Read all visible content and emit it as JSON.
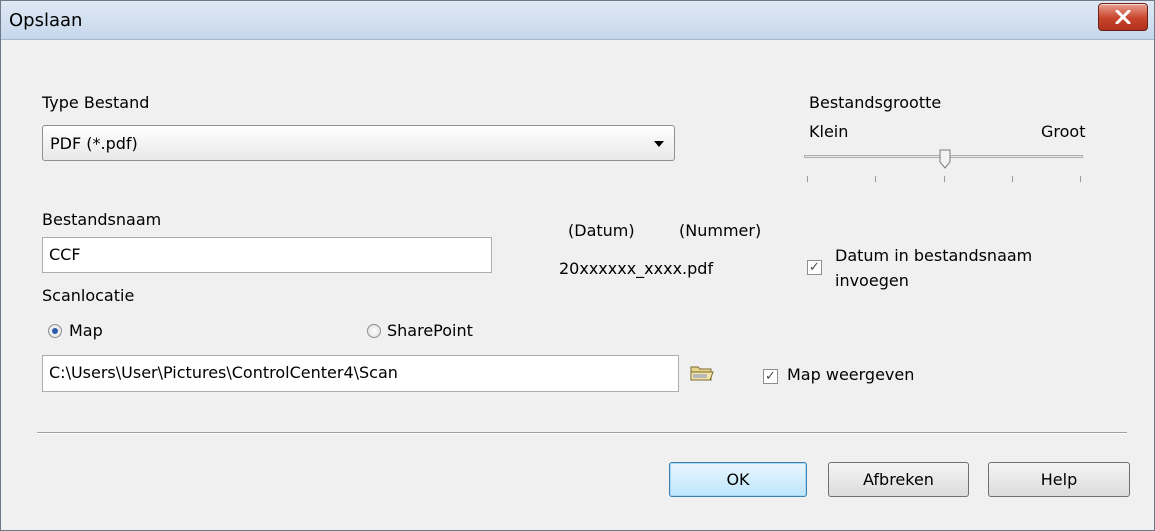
{
  "window": {
    "title": "Opslaan",
    "close_icon": "close-icon"
  },
  "file_type": {
    "label": "Type Bestand",
    "value": "PDF (*.pdf)"
  },
  "file_size": {
    "label": "Bestandsgrootte",
    "min_label": "Klein",
    "max_label": "Groot",
    "level": 0.5
  },
  "file_name": {
    "label": "Bestandsnaam",
    "value": "CCF",
    "date_label": "(Datum)",
    "number_label": "(Nummer)",
    "example": "20xxxxxx_xxxx.pdf"
  },
  "insert_date": {
    "label_line1": "Datum in bestandsnaam",
    "label_line2": "invoegen",
    "checked": true
  },
  "scan_location": {
    "label": "Scanlocatie",
    "options": [
      {
        "label": "Map",
        "checked": true
      },
      {
        "label": "SharePoint",
        "checked": false
      }
    ],
    "path": "C:\\Users\\User\\Pictures\\ControlCenter4\\Scan",
    "browse_icon": "folder-icon"
  },
  "show_folder": {
    "label": "Map weergeven",
    "checked": true
  },
  "buttons": {
    "ok": "OK",
    "cancel": "Afbreken",
    "help": "Help"
  }
}
